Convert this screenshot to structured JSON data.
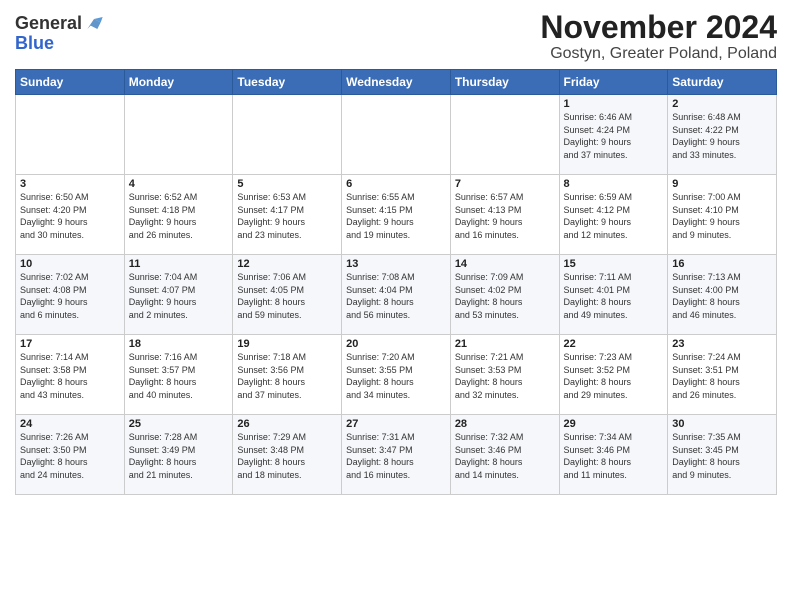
{
  "header": {
    "logo_line1": "General",
    "logo_line2": "Blue",
    "title": "November 2024",
    "subtitle": "Gostyn, Greater Poland, Poland"
  },
  "weekdays": [
    "Sunday",
    "Monday",
    "Tuesday",
    "Wednesday",
    "Thursday",
    "Friday",
    "Saturday"
  ],
  "weeks": [
    [
      {
        "day": "",
        "info": ""
      },
      {
        "day": "",
        "info": ""
      },
      {
        "day": "",
        "info": ""
      },
      {
        "day": "",
        "info": ""
      },
      {
        "day": "",
        "info": ""
      },
      {
        "day": "1",
        "info": "Sunrise: 6:46 AM\nSunset: 4:24 PM\nDaylight: 9 hours\nand 37 minutes."
      },
      {
        "day": "2",
        "info": "Sunrise: 6:48 AM\nSunset: 4:22 PM\nDaylight: 9 hours\nand 33 minutes."
      }
    ],
    [
      {
        "day": "3",
        "info": "Sunrise: 6:50 AM\nSunset: 4:20 PM\nDaylight: 9 hours\nand 30 minutes."
      },
      {
        "day": "4",
        "info": "Sunrise: 6:52 AM\nSunset: 4:18 PM\nDaylight: 9 hours\nand 26 minutes."
      },
      {
        "day": "5",
        "info": "Sunrise: 6:53 AM\nSunset: 4:17 PM\nDaylight: 9 hours\nand 23 minutes."
      },
      {
        "day": "6",
        "info": "Sunrise: 6:55 AM\nSunset: 4:15 PM\nDaylight: 9 hours\nand 19 minutes."
      },
      {
        "day": "7",
        "info": "Sunrise: 6:57 AM\nSunset: 4:13 PM\nDaylight: 9 hours\nand 16 minutes."
      },
      {
        "day": "8",
        "info": "Sunrise: 6:59 AM\nSunset: 4:12 PM\nDaylight: 9 hours\nand 12 minutes."
      },
      {
        "day": "9",
        "info": "Sunrise: 7:00 AM\nSunset: 4:10 PM\nDaylight: 9 hours\nand 9 minutes."
      }
    ],
    [
      {
        "day": "10",
        "info": "Sunrise: 7:02 AM\nSunset: 4:08 PM\nDaylight: 9 hours\nand 6 minutes."
      },
      {
        "day": "11",
        "info": "Sunrise: 7:04 AM\nSunset: 4:07 PM\nDaylight: 9 hours\nand 2 minutes."
      },
      {
        "day": "12",
        "info": "Sunrise: 7:06 AM\nSunset: 4:05 PM\nDaylight: 8 hours\nand 59 minutes."
      },
      {
        "day": "13",
        "info": "Sunrise: 7:08 AM\nSunset: 4:04 PM\nDaylight: 8 hours\nand 56 minutes."
      },
      {
        "day": "14",
        "info": "Sunrise: 7:09 AM\nSunset: 4:02 PM\nDaylight: 8 hours\nand 53 minutes."
      },
      {
        "day": "15",
        "info": "Sunrise: 7:11 AM\nSunset: 4:01 PM\nDaylight: 8 hours\nand 49 minutes."
      },
      {
        "day": "16",
        "info": "Sunrise: 7:13 AM\nSunset: 4:00 PM\nDaylight: 8 hours\nand 46 minutes."
      }
    ],
    [
      {
        "day": "17",
        "info": "Sunrise: 7:14 AM\nSunset: 3:58 PM\nDaylight: 8 hours\nand 43 minutes."
      },
      {
        "day": "18",
        "info": "Sunrise: 7:16 AM\nSunset: 3:57 PM\nDaylight: 8 hours\nand 40 minutes."
      },
      {
        "day": "19",
        "info": "Sunrise: 7:18 AM\nSunset: 3:56 PM\nDaylight: 8 hours\nand 37 minutes."
      },
      {
        "day": "20",
        "info": "Sunrise: 7:20 AM\nSunset: 3:55 PM\nDaylight: 8 hours\nand 34 minutes."
      },
      {
        "day": "21",
        "info": "Sunrise: 7:21 AM\nSunset: 3:53 PM\nDaylight: 8 hours\nand 32 minutes."
      },
      {
        "day": "22",
        "info": "Sunrise: 7:23 AM\nSunset: 3:52 PM\nDaylight: 8 hours\nand 29 minutes."
      },
      {
        "day": "23",
        "info": "Sunrise: 7:24 AM\nSunset: 3:51 PM\nDaylight: 8 hours\nand 26 minutes."
      }
    ],
    [
      {
        "day": "24",
        "info": "Sunrise: 7:26 AM\nSunset: 3:50 PM\nDaylight: 8 hours\nand 24 minutes."
      },
      {
        "day": "25",
        "info": "Sunrise: 7:28 AM\nSunset: 3:49 PM\nDaylight: 8 hours\nand 21 minutes."
      },
      {
        "day": "26",
        "info": "Sunrise: 7:29 AM\nSunset: 3:48 PM\nDaylight: 8 hours\nand 18 minutes."
      },
      {
        "day": "27",
        "info": "Sunrise: 7:31 AM\nSunset: 3:47 PM\nDaylight: 8 hours\nand 16 minutes."
      },
      {
        "day": "28",
        "info": "Sunrise: 7:32 AM\nSunset: 3:46 PM\nDaylight: 8 hours\nand 14 minutes."
      },
      {
        "day": "29",
        "info": "Sunrise: 7:34 AM\nSunset: 3:46 PM\nDaylight: 8 hours\nand 11 minutes."
      },
      {
        "day": "30",
        "info": "Sunrise: 7:35 AM\nSunset: 3:45 PM\nDaylight: 8 hours\nand 9 minutes."
      }
    ]
  ]
}
